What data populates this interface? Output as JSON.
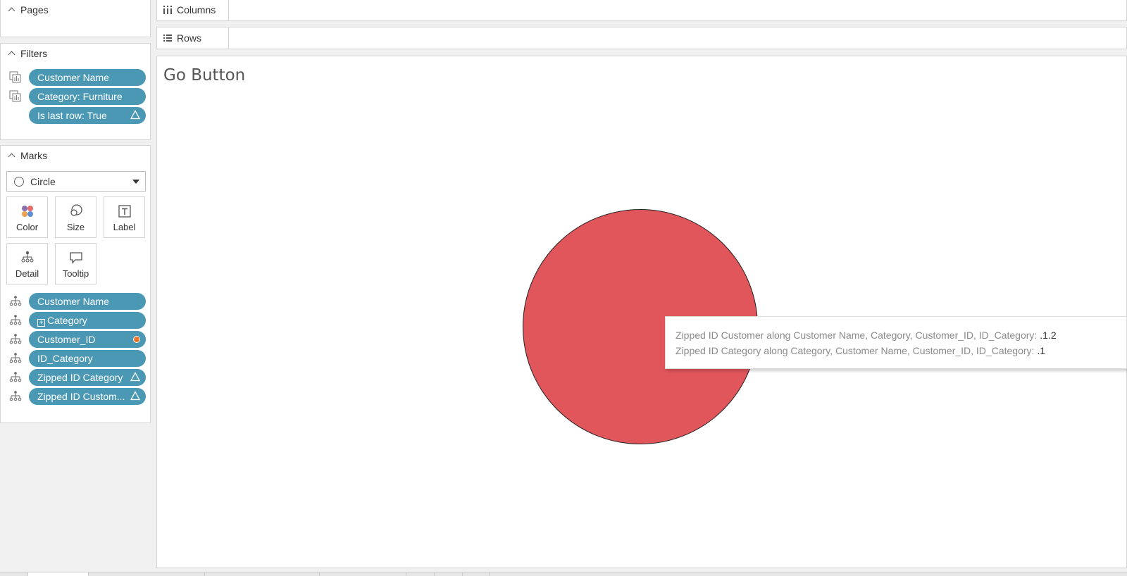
{
  "pages": {
    "title": "Pages"
  },
  "filters": {
    "title": "Filters",
    "items": [
      {
        "label": "Customer Name"
      },
      {
        "label": "Category: Furniture"
      },
      {
        "label": "Is last row: True"
      }
    ]
  },
  "marks": {
    "title": "Marks",
    "mark_type": "Circle",
    "buttons": {
      "color": "Color",
      "size": "Size",
      "label": "Label",
      "detail": "Detail",
      "tooltip": "Tooltip"
    },
    "fields": [
      {
        "label": "Customer Name"
      },
      {
        "label": "Category"
      },
      {
        "label": "Customer_ID"
      },
      {
        "label": "ID_Category"
      },
      {
        "label": "Zipped ID Category"
      },
      {
        "label": "Zipped ID Custom..."
      }
    ]
  },
  "shelves": {
    "columns": "Columns",
    "rows": "Rows"
  },
  "view": {
    "title": "Go Button",
    "mark_color": "#e0565b"
  },
  "tooltip": {
    "lines": [
      {
        "label": "Zipped ID Customer along Customer Name, Category, Customer_ID, ID_Category:",
        "value": ".1.2"
      },
      {
        "label": "Zipped ID Category along Category, Customer Name, Customer_ID, ID_Category:",
        "value": ".1"
      }
    ]
  },
  "colors": {
    "pill": "#4a98b4",
    "mark": "#e0565b",
    "accent_dot": "#e8752a"
  }
}
